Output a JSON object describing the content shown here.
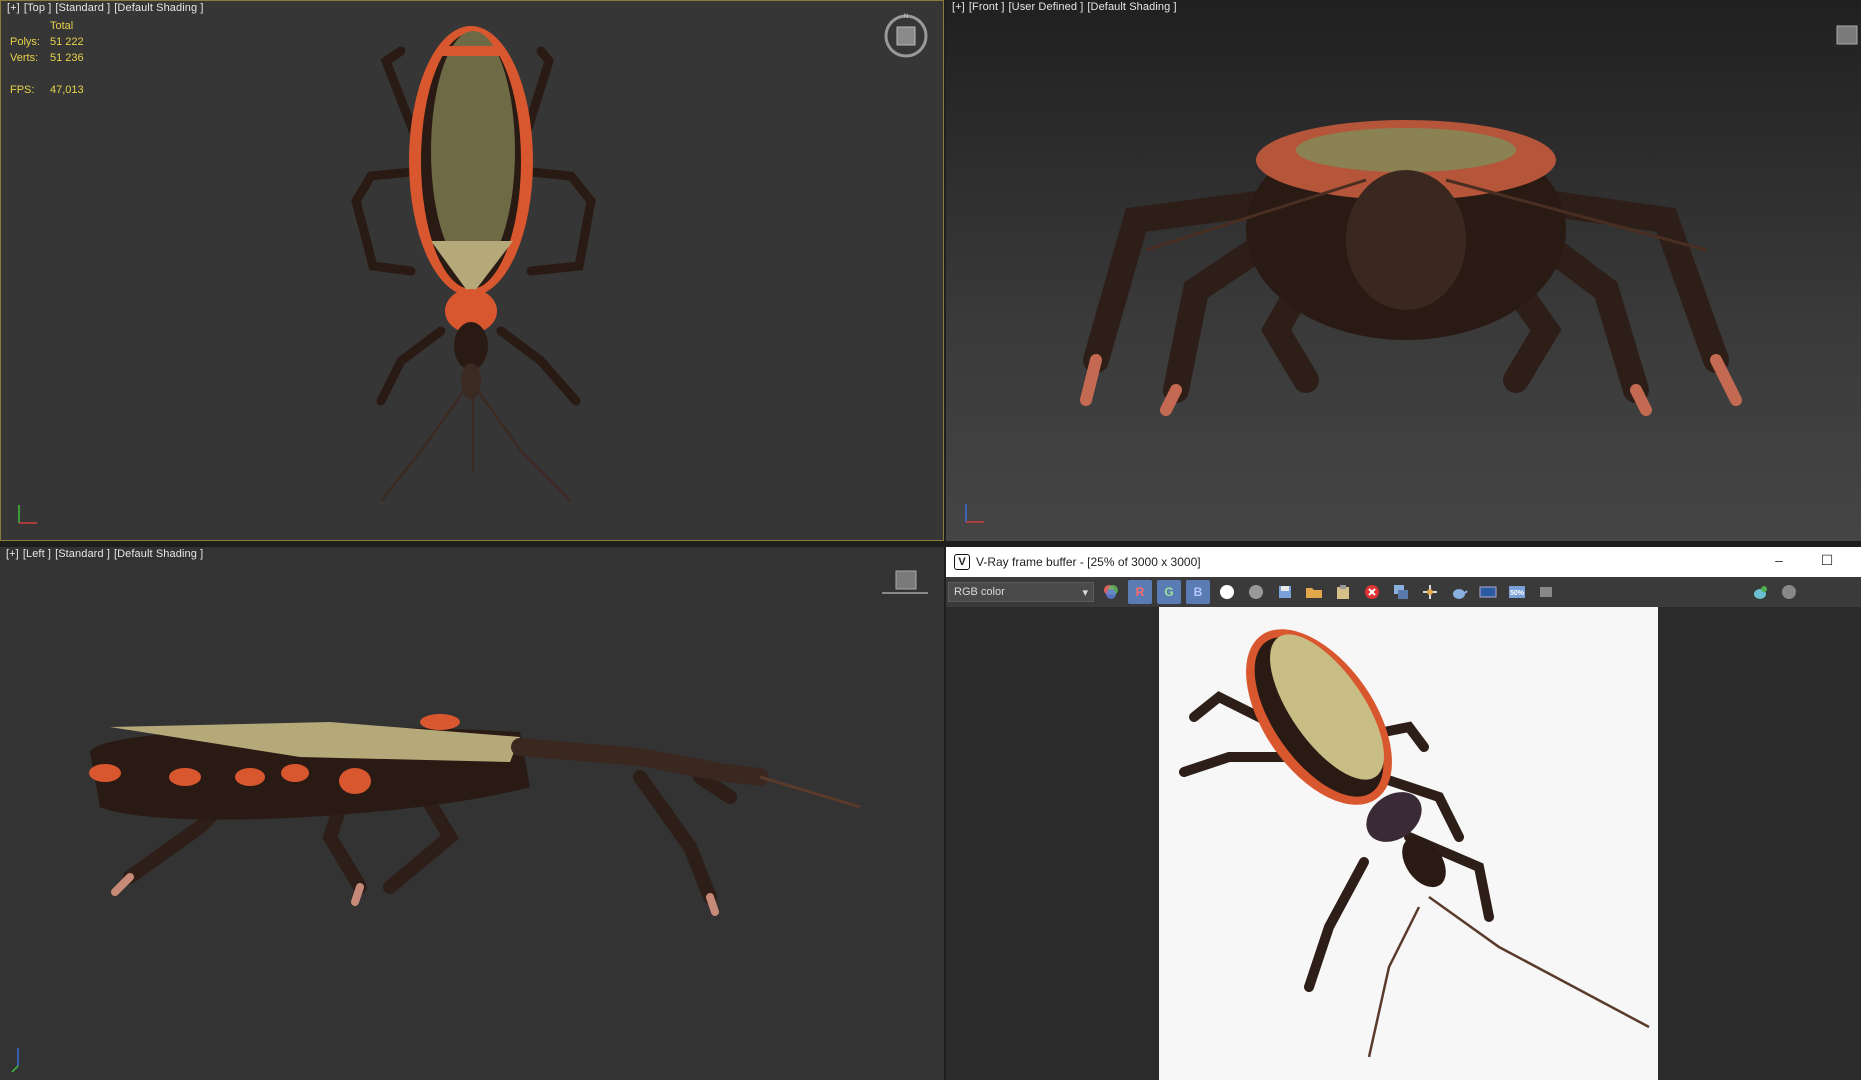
{
  "viewports": {
    "top": {
      "plus": "[+]",
      "view": "[Top ]",
      "shading_mode": "[Standard ]",
      "shading": "[Default Shading ]"
    },
    "front": {
      "plus": "[+]",
      "view": "[Front ]",
      "shading_mode": "[User Defined ]",
      "shading": "[Default Shading ]"
    },
    "left": {
      "plus": "[+]",
      "view": "[Left ]",
      "shading_mode": "[Standard ]",
      "shading": "[Default Shading ]"
    }
  },
  "stats": {
    "header": "Total",
    "polys_label": "Polys:",
    "polys_value": "51 222",
    "verts_label": "Verts:",
    "verts_value": "51 236",
    "fps_label": "FPS:",
    "fps_value": "47,013"
  },
  "vfb": {
    "title": "V-Ray frame buffer - [25% of 3000 x 3000]",
    "logo": "V",
    "minimize": "–",
    "maximize": "☐",
    "channel": "RGB color",
    "channel_arrow": "▾",
    "r_label": "R",
    "g_label": "G",
    "b_label": "B"
  },
  "colors": {
    "stats": "#e8d24a",
    "active_border": "#8a7d3a",
    "channel_button": "#5b7bb5",
    "bug_orange": "#d9572e",
    "bug_dark": "#2a1a14",
    "wing": "#b5a97a"
  }
}
